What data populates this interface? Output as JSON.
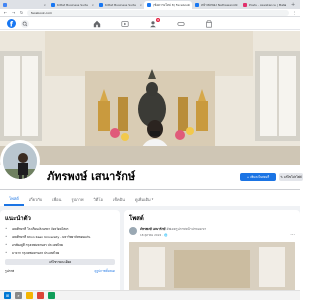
{
  "browser": {
    "tabs": [
      {
        "label": "",
        "color": "#4285f4",
        "active": false
      },
      {
        "label": "Kittat Business Suite",
        "color": "#1877f2",
        "active": false
      },
      {
        "label": "Kittat Business Suite",
        "color": "#1877f2",
        "active": false
      },
      {
        "label": "(ข้อความใหม่ 8) Facebook",
        "color": "#1877f2",
        "active": true
      },
      {
        "label": "หน้าเพจของ Nathawanich",
        "color": "#1877f2",
        "active": false
      },
      {
        "label": "Posts - Assistance | Meta",
        "color": "#e1306c",
        "active": false
      }
    ],
    "new_tab": "+",
    "url": "facebook.com"
  },
  "fbnav": {
    "badge": "8"
  },
  "profile": {
    "name": "ภัทรพงษ์ เสนารักษ์",
    "add_story_label": "+ เพิ่มลงในสตอรี่",
    "edit_label": "✎ แก้ไขโปรไฟล์"
  },
  "profile_tabs": [
    {
      "label": "โพสต์",
      "active": true
    },
    {
      "label": "เกี่ยวกับ",
      "active": false
    },
    {
      "label": "เพื่อน",
      "active": false
    },
    {
      "label": "รูปภาพ",
      "active": false
    },
    {
      "label": "วิดีโอ",
      "active": false
    },
    {
      "label": "เช็คอิน",
      "active": false
    },
    {
      "label": "ดูเพิ่มเติม",
      "active": false
    }
  ],
  "intro": {
    "title": "แนะนำตัว",
    "items": [
      "เคยศึกษาที่ โรงเรียนเลิงนกทา จังหวัดยโสธร",
      "เคยศึกษาที่ Khon Kaen University - มหาวิทยาลัยขอนแก่น",
      "อาศัยอยู่ที่ กรุงเทพมหานคร ประเทศไทย",
      "มาจาก กรุงเทพมหานคร ประเทศไทย"
    ],
    "edit_label": "แก้ไขรายละเอียด",
    "footer_left": "รูปภาพ",
    "footer_link": "ดูรูปภาพทั้งหมด"
  },
  "posts": {
    "title": "โพสต์",
    "author": "ภัทรพงษ์ เสนารักษ์",
    "action": " อัพเดตรูปภาพหน้าปกของเขา",
    "date": "18 ตุลาคม 2022 · ",
    "menu": "···"
  },
  "colors": {
    "fb_blue": "#1b74e4",
    "badge_red": "#e41e3f"
  }
}
